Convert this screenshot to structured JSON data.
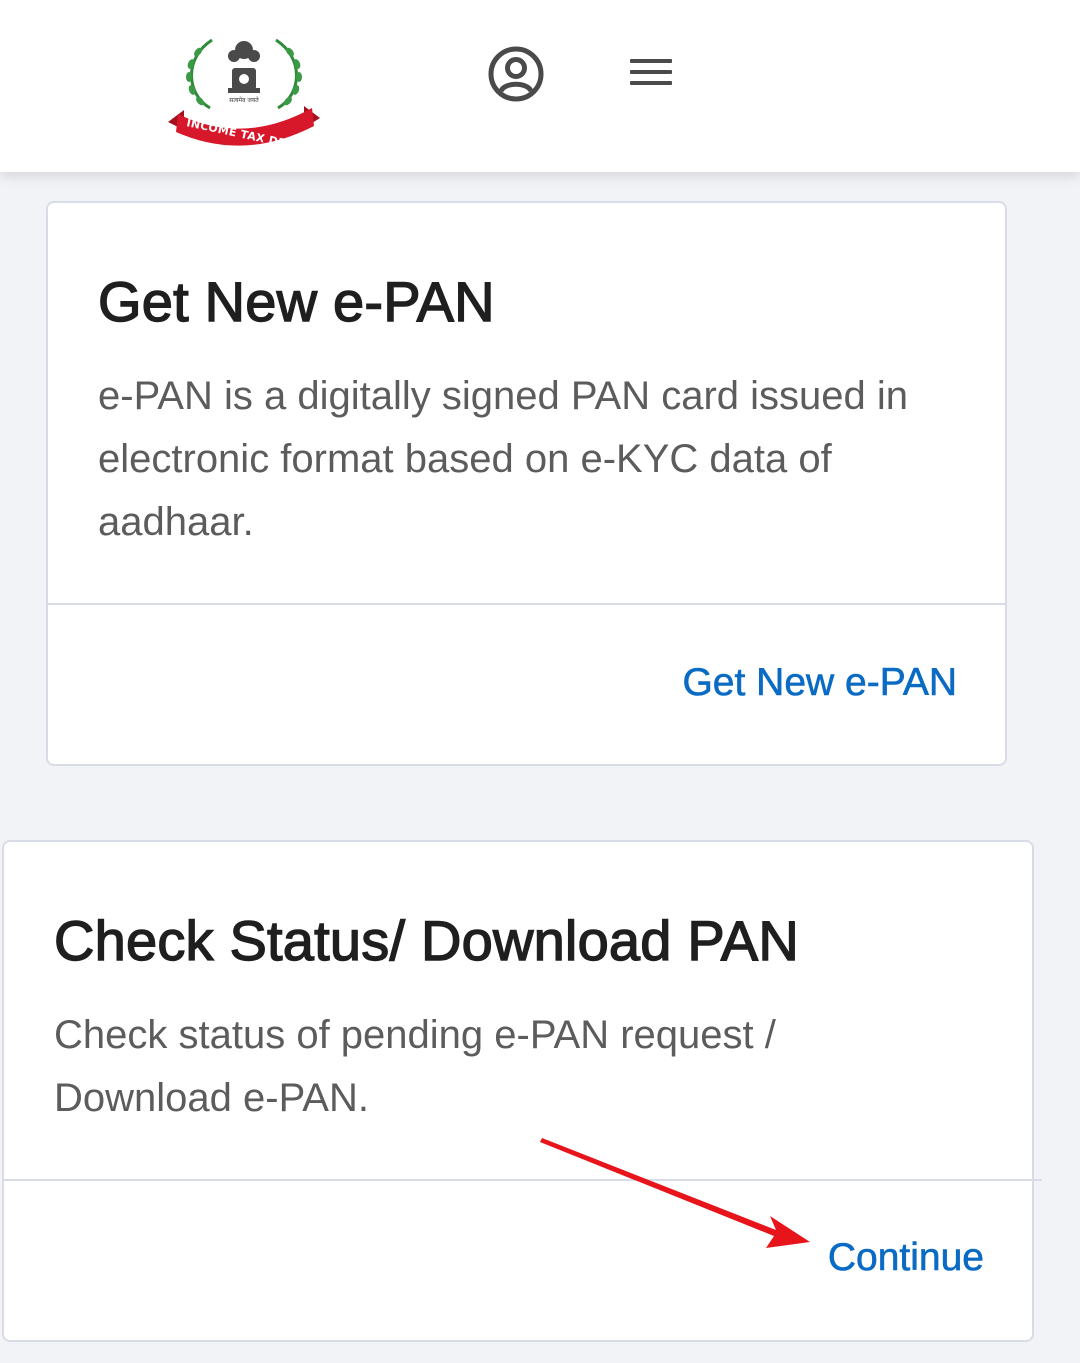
{
  "header": {
    "logo_text": "INCOME TAX DEPARTMENT",
    "emblem_motto": "सत्यमेव जयते",
    "profile_icon": "user-circle-icon",
    "menu_icon": "hamburger-menu-icon"
  },
  "cards": [
    {
      "title": "Get New e-PAN",
      "description": "e-PAN is a digitally signed PAN card issued in electronic format based on e-KYC data of aadhaar.",
      "action_label": "Get New e-PAN"
    },
    {
      "title": "Check Status/ Download PAN",
      "description": "Check status of pending e-PAN request / Download e-PAN.",
      "action_label": "Continue"
    }
  ],
  "annotation": {
    "arrow_icon": "red-arrow-annotation",
    "color": "#e8141b"
  },
  "colors": {
    "link": "#0a6bc4",
    "background": "#f2f3f7",
    "logo_ribbon": "#d7182a"
  }
}
